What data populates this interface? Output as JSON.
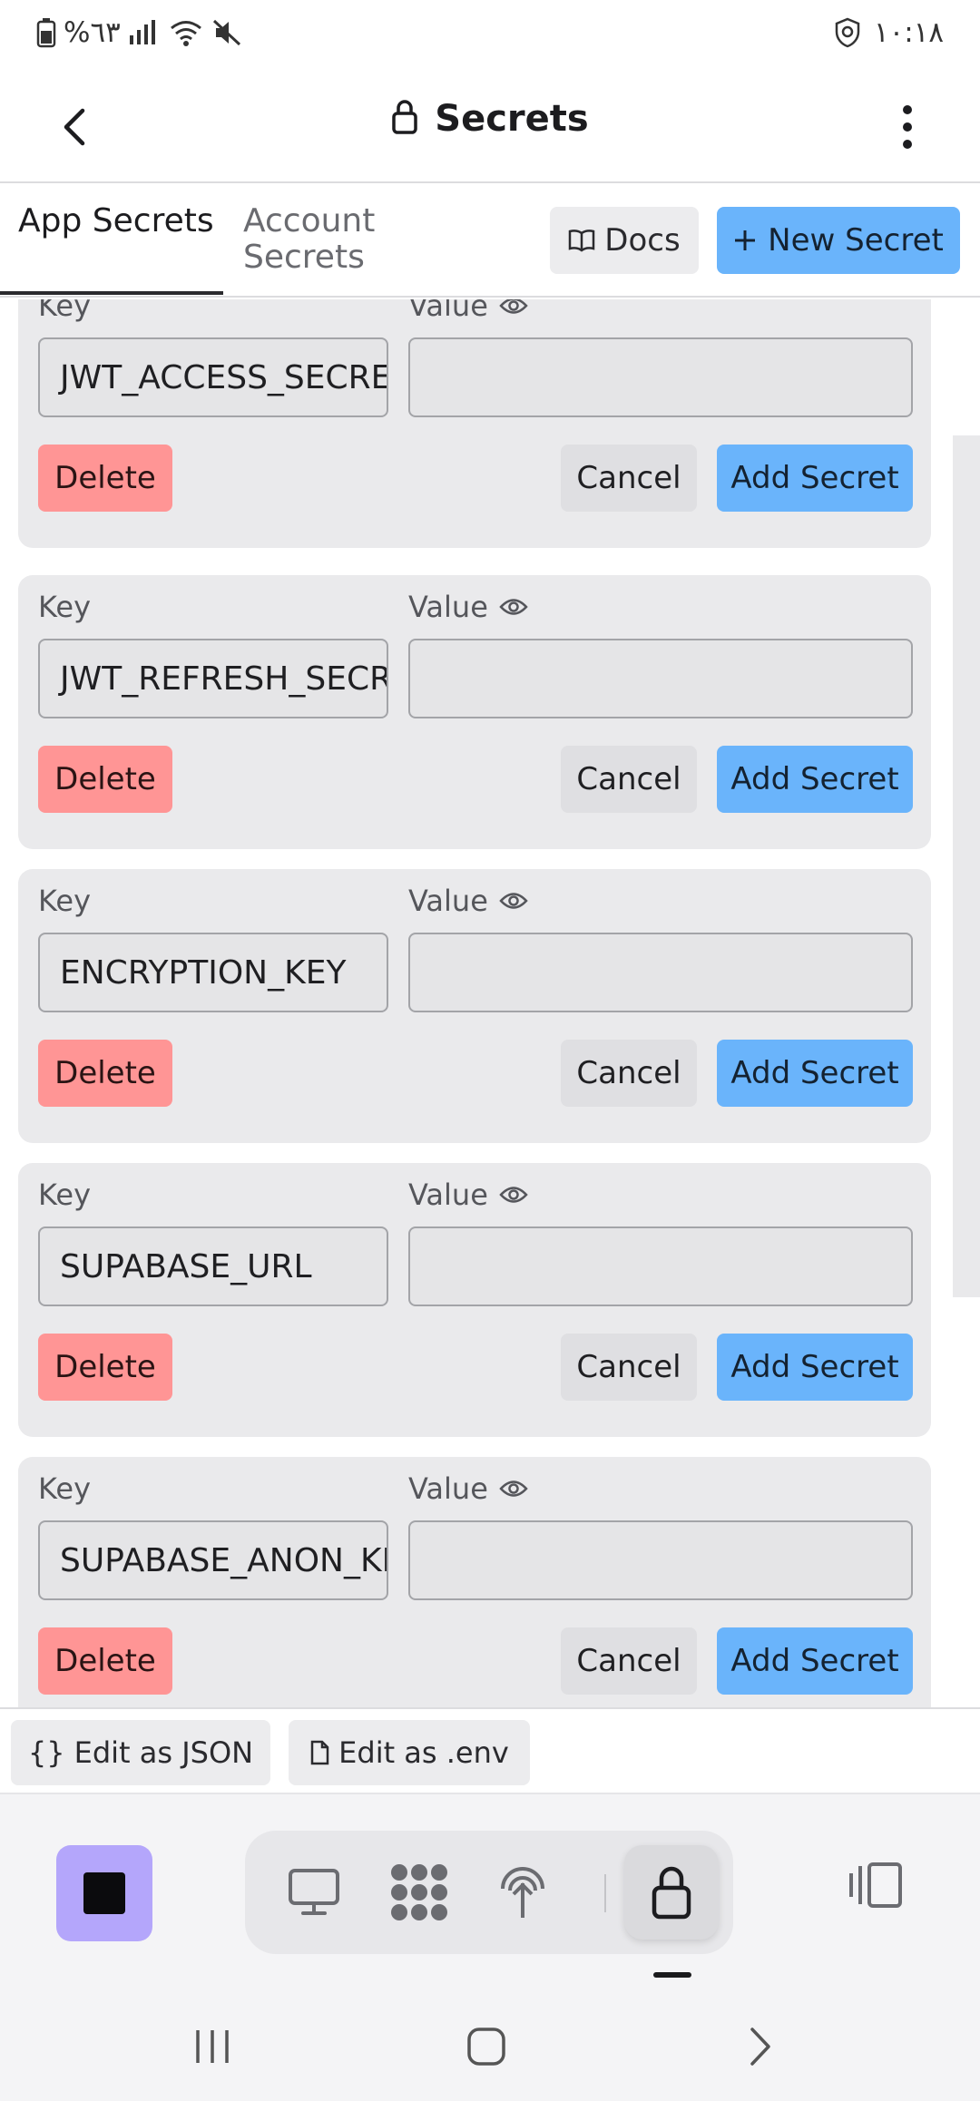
{
  "status_bar": {
    "battery": "%٦٣",
    "time": "١٠:١٨"
  },
  "header": {
    "title": "Secrets",
    "back_icon": "chevron-left-icon",
    "lock_icon": "lock-icon",
    "more_icon": "more-vertical-icon"
  },
  "tabs": [
    {
      "label": "App Secrets",
      "active": true
    },
    {
      "label": "Account Secrets",
      "active": false
    }
  ],
  "toolbar": {
    "docs_label": "Docs",
    "new_secret_label": "New Secret"
  },
  "secret_form": {
    "key_label": "Key",
    "value_label": "Value",
    "delete_label": "Delete",
    "cancel_label": "Cancel",
    "add_label": "Add Secret"
  },
  "secrets": [
    {
      "key": "JWT_ACCESS_SECRET",
      "value": ""
    },
    {
      "key": "JWT_REFRESH_SECRET",
      "value": ""
    },
    {
      "key": "ENCRYPTION_KEY",
      "value": ""
    },
    {
      "key": "SUPABASE_URL",
      "value": ""
    },
    {
      "key": "SUPABASE_ANON_KEY",
      "value": ""
    }
  ],
  "edit_bar": {
    "json_label": "Edit as JSON",
    "json_icon": "{}",
    "env_label": "Edit as .env"
  },
  "dock": {
    "items": [
      "monitor-icon",
      "apps-grid-icon",
      "deploy-icon",
      "lock-icon"
    ],
    "active_item": "lock-icon"
  },
  "colors": {
    "primary": "#6ab4fb",
    "danger": "#ff9595",
    "stop": "#b4a6fb"
  }
}
